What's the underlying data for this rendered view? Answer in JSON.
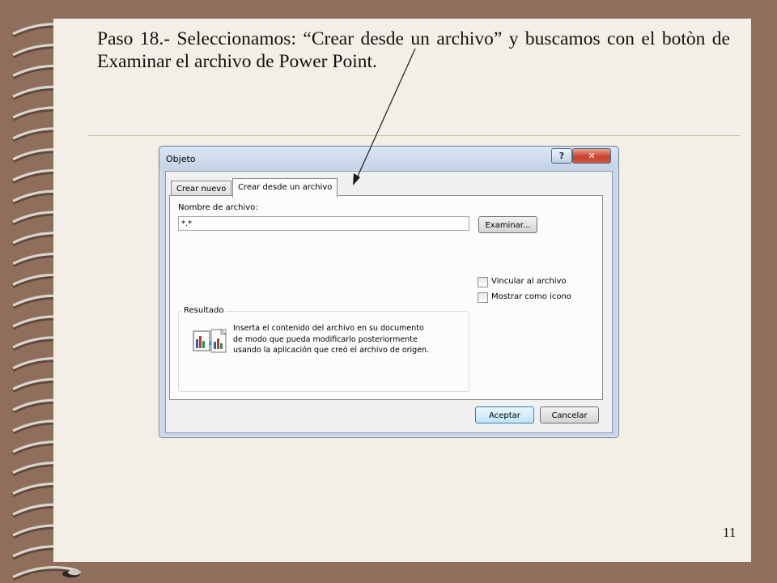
{
  "slide": {
    "title": "Paso 18.- Seleccionamos: “Crear desde un archivo” y buscamos con el botòn de Examinar el archivo de Power Point.",
    "page_number": "11"
  },
  "dialog": {
    "title": "Objeto",
    "help_label": "?",
    "close_label": "✕",
    "tabs": [
      {
        "label": "Crear nuevo",
        "selected": false
      },
      {
        "label": "Crear desde un archivo",
        "selected": true
      }
    ],
    "file_name_label": "Nombre de archivo:",
    "file_name_value": "*.*",
    "browse_label": "Examinar...",
    "options": [
      {
        "label": "Vincular al archivo",
        "checked": false
      },
      {
        "label": "Mostrar como icono",
        "checked": false
      }
    ],
    "result": {
      "title": "Resultado",
      "text": "Inserta el contenido del archivo en su documento de modo que pueda modificarlo posteriormente usando la aplicación que creó el archivo de origen."
    },
    "ok_label": "Aceptar",
    "cancel_label": "Cancelar"
  },
  "colors": {
    "background": "#8f6e5b",
    "slide": "#f3efe6",
    "dialog_frame": "#c8d6e8",
    "close_button": "#c8432a",
    "default_button_border": "#3c7fb1"
  },
  "icons": [
    "spiral-binding",
    "help-icon",
    "close-icon",
    "chart-document-icon",
    "arrow-pointer"
  ]
}
